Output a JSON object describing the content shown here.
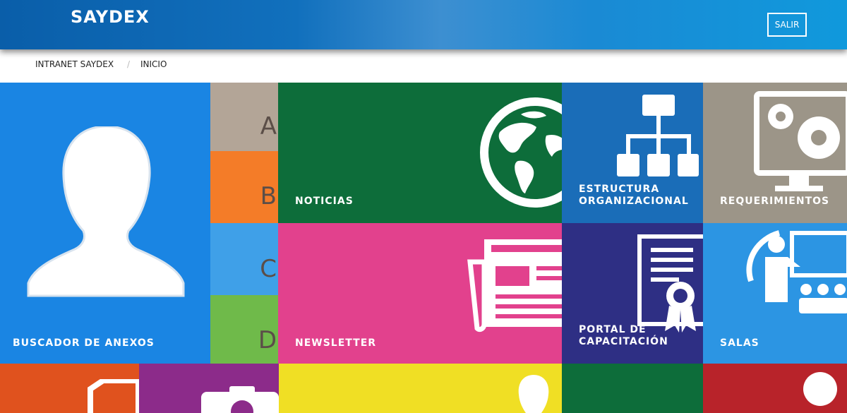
{
  "header": {
    "logo": "SAYDEX",
    "logout_label": "SALIR"
  },
  "breadcrumb": {
    "items": [
      "INTRANET SAYDEX",
      "INICIO"
    ],
    "separator": "/"
  },
  "tiles": {
    "buscador": {
      "label": "BUSCADOR DE ANEXOS",
      "color": "#1a85e3",
      "icon": "person-silhouette-icon"
    },
    "letters": [
      {
        "letter": "A",
        "color": "#b3a597"
      },
      {
        "letter": "B",
        "color": "#f47c28"
      },
      {
        "letter": "C",
        "color": "#3fa0e8"
      },
      {
        "letter": "D",
        "color": "#6fba4a"
      }
    ],
    "noticias": {
      "label": "NOTICIAS",
      "color": "#0d6d3a",
      "icon": "globe-icon"
    },
    "estructura": {
      "label_line1": "ESTRUCTURA",
      "label_line2": "ORGANIZACIONAL",
      "color": "#1a6db8",
      "icon": "org-chart-icon"
    },
    "requerimientos": {
      "label": "REQUERIMIENTOS",
      "color": "#9c9588",
      "icon": "monitor-gears-icon"
    },
    "newsletter": {
      "label": "NEWSLETTER",
      "color": "#e2418d",
      "icon": "newspaper-icon"
    },
    "portal": {
      "label_line1": "PORTAL DE",
      "label_line2": "CAPACITACIÓN",
      "color": "#2e2f84",
      "icon": "certificate-icon"
    },
    "salas": {
      "label": "SALAS",
      "color": "#2c95e3",
      "icon": "presentation-room-icon"
    },
    "bottom": [
      {
        "color": "#e0521e",
        "icon": "document-icon"
      },
      {
        "color": "#8c2b8a",
        "icon": "camera-icon"
      },
      {
        "color": "#f0df24",
        "icon": "person-icon"
      },
      {
        "color": "#0d6d3a",
        "icon": ""
      },
      {
        "color": "#b8232a",
        "icon": "user-icon"
      }
    ]
  }
}
